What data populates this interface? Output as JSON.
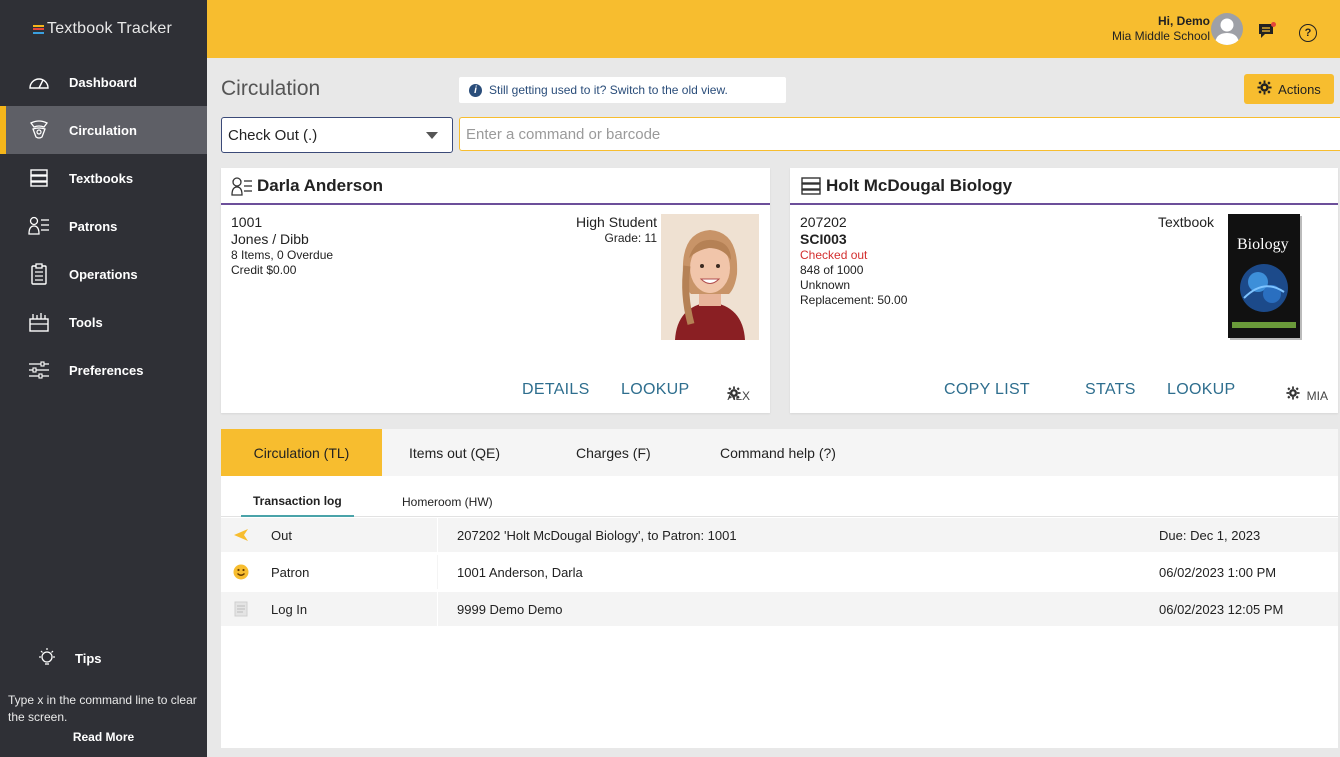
{
  "app": {
    "brand": "Textbook Tracker"
  },
  "sidebar": {
    "items": [
      {
        "label": "Dashboard",
        "icon": "gauge-icon"
      },
      {
        "label": "Circulation",
        "icon": "circulation-icon"
      },
      {
        "label": "Textbooks",
        "icon": "books-icon"
      },
      {
        "label": "Patrons",
        "icon": "patrons-icon"
      },
      {
        "label": "Operations",
        "icon": "clipboard-icon"
      },
      {
        "label": "Tools",
        "icon": "toolbox-icon"
      },
      {
        "label": "Preferences",
        "icon": "sliders-icon"
      }
    ],
    "tips": {
      "title": "Tips",
      "text": "Type x in the command line to clear the screen.",
      "read_more": "Read More"
    }
  },
  "topbar": {
    "greeting": "Hi, Demo",
    "school": "Mia Middle School",
    "help": "?"
  },
  "header": {
    "title": "Circulation",
    "banner": "Still getting used to it? Switch to the old view.",
    "actions_label": "Actions"
  },
  "command": {
    "mode": "Check Out (.)",
    "placeholder": "Enter a command or barcode"
  },
  "patron_card": {
    "name": "Darla Anderson",
    "id": "1001",
    "homeroom": "Jones / Dibb",
    "items": "8 Items, 0 Overdue",
    "credit": "Credit $0.00",
    "type": "High Student",
    "grade": "Grade: 11",
    "site": "ALX",
    "links": [
      "DETAILS",
      "LOOKUP"
    ]
  },
  "book_card": {
    "title": "Holt McDougal Biology",
    "barcode": "207202",
    "code": "SCI003",
    "status": "Checked out",
    "count": "848 of 1000",
    "condition": "Unknown",
    "replacement": "Replacement: 50.00",
    "type": "Textbook",
    "cover_title": "Biology",
    "site": "MIA",
    "links": [
      "COPY LIST",
      "STATS",
      "LOOKUP"
    ]
  },
  "tabs": [
    {
      "label": "Circulation (TL)",
      "active": true
    },
    {
      "label": "Items out (QE)"
    },
    {
      "label": "Charges (F)"
    },
    {
      "label": "Command help (?)"
    }
  ],
  "subtabs": [
    {
      "label": "Transaction log",
      "active": true
    },
    {
      "label": "Homeroom (HW)"
    }
  ],
  "log": [
    {
      "type": "Out",
      "icon": "arrow-out-icon",
      "detail": "207202 'Holt McDougal Biology', to Patron: 1001",
      "when": "Due: Dec 1, 2023"
    },
    {
      "type": "Patron",
      "icon": "smiley-icon",
      "detail": "1001 Anderson, Darla",
      "when": "06/02/2023 1:00 PM"
    },
    {
      "type": "Log In",
      "icon": "document-icon",
      "detail": "9999 Demo Demo",
      "when": "06/02/2023 12:05 PM"
    }
  ],
  "colors": {
    "accent": "#f7bd2f",
    "sidebar": "#2f3036",
    "link": "#2e6e8e",
    "status_red": "#d32f2f",
    "card_rule": "#6c4f9a"
  }
}
